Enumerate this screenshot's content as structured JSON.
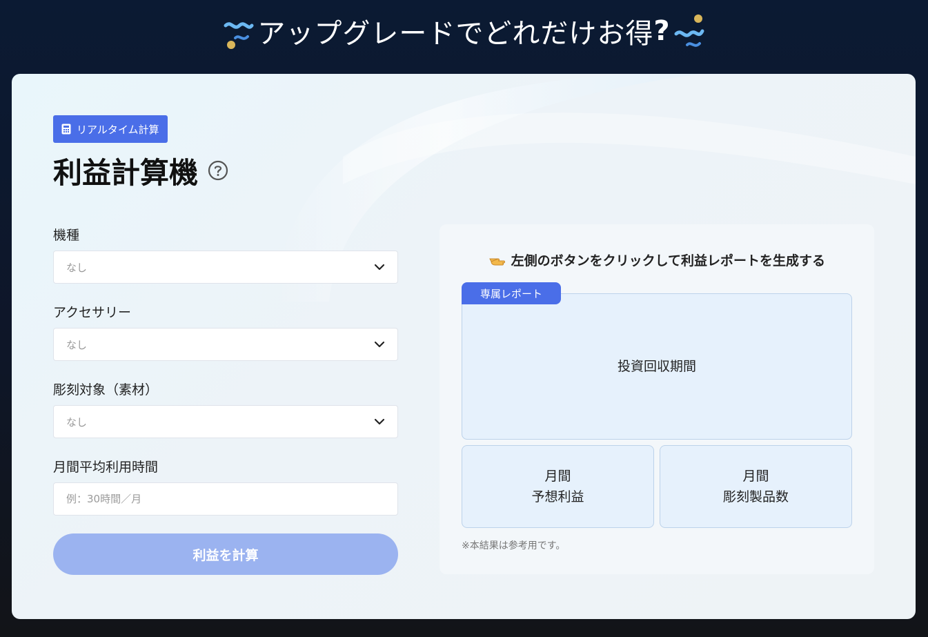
{
  "header": {
    "title": "アップグレードでどれだけお得",
    "title_mark": "?"
  },
  "calculator": {
    "badge": "リアルタイム計算",
    "title": "利益計算機",
    "fields": [
      {
        "label": "機種",
        "value": "なし"
      },
      {
        "label": "アクセサリー",
        "value": "なし"
      },
      {
        "label": "彫刻対象（素材）",
        "value": "なし"
      },
      {
        "label": "月間平均利用時間",
        "placeholder": "例：30時間／月"
      }
    ],
    "submit_label": "利益を計算"
  },
  "report": {
    "hint": "左側のボタンをクリックして利益レポートを生成する",
    "tab_label": "専属レポート",
    "payback_label": "投資回収期間",
    "profit_line1": "月間",
    "profit_line2": "予想利益",
    "products_line1": "月間",
    "products_line2": "彫刻製品数",
    "note": "※本結果は参考用です。"
  },
  "colors": {
    "accent": "#4a6ee8",
    "button_disabled": "#9bb3f0",
    "background_dark": "#0e1628"
  },
  "icons": {
    "badge": "calculator-icon",
    "title": "question-circle-icon",
    "select": "chevron-down-icon",
    "hint": "pointing-hand-icon"
  }
}
